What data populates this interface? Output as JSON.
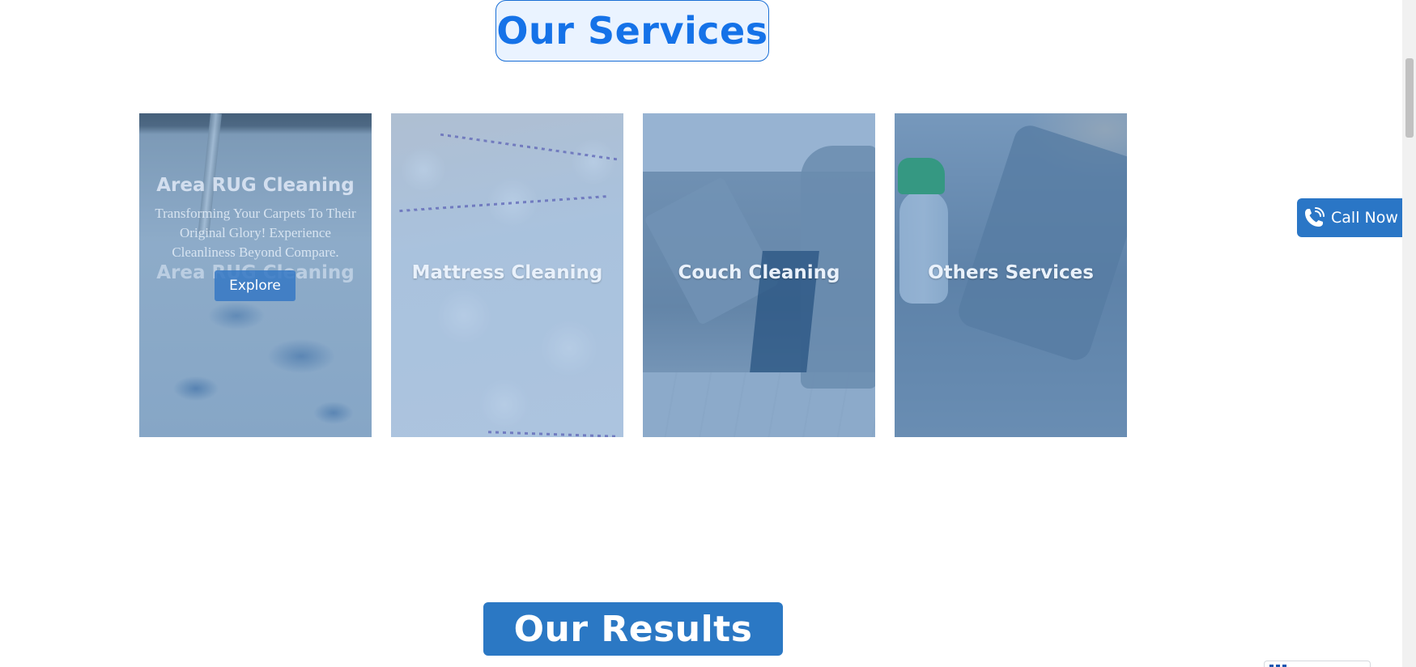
{
  "services_section": {
    "title": "Our Services"
  },
  "cards": [
    {
      "title": "Area RUG Cleaning",
      "hover_title": "Area RUG Cleaning",
      "description": "Transforming Your Carpets To Their Original Glory! Experience Cleanliness Beyond Compare.",
      "button_label": "Explore"
    },
    {
      "title": "Mattress Cleaning"
    },
    {
      "title": "Couch Cleaning"
    },
    {
      "title": "Others Services"
    }
  ],
  "results_section": {
    "title": "Our Results"
  },
  "call_now": {
    "label": "Call Now",
    "icon": "phone-icon"
  },
  "colors": {
    "brand_blue": "#2a76c6",
    "heading_blue": "#1572e8",
    "heading_bg": "#eaf3ff"
  }
}
